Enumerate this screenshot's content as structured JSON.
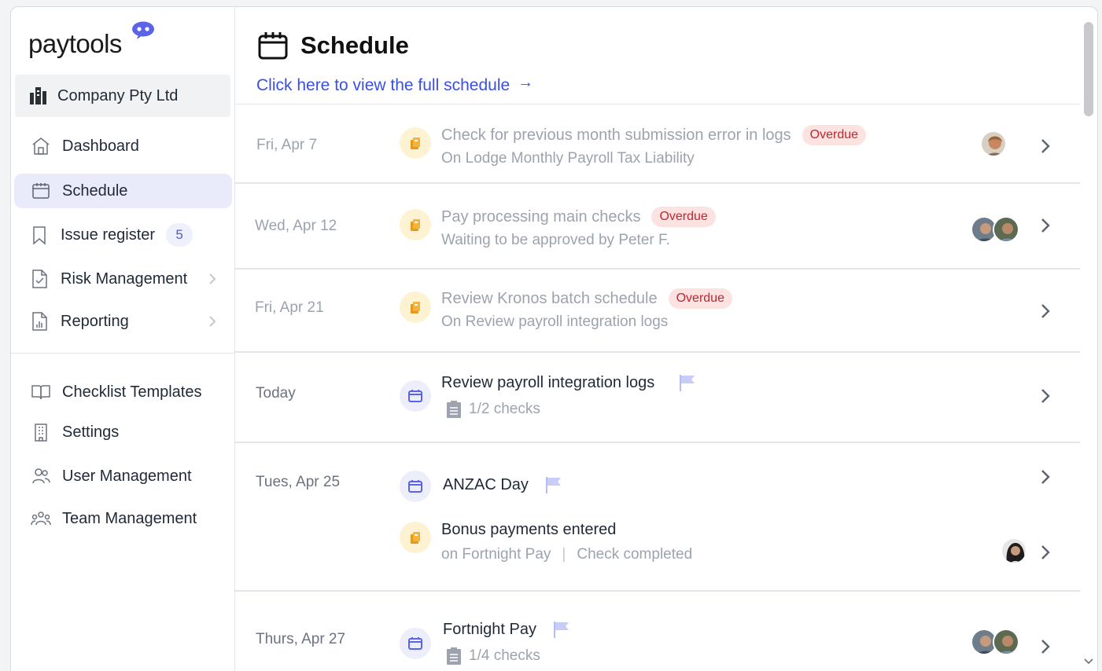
{
  "brand": {
    "name": "paytools",
    "accent": "#4f5bd5",
    "link": "#3b4fe0"
  },
  "company": {
    "name": "Company Pty Ltd"
  },
  "nav": {
    "dashboard": "Dashboard",
    "schedule": "Schedule",
    "issue_register": "Issue register",
    "issue_count": "5",
    "risk": "Risk Management",
    "reporting": "Reporting",
    "checklist_templates": "Checklist Templates",
    "settings": "Settings",
    "user_management": "User Management",
    "team_management": "Team Management"
  },
  "page": {
    "title": "Schedule",
    "full_link": "Click here to view the full schedule",
    "link_arrow": "→"
  },
  "rows": [
    {
      "date": "Fri, Apr 7",
      "title": "Check for previous month submission error in logs",
      "status": "Overdue",
      "sub": "On Lodge Monthly Payroll Tax Liability"
    },
    {
      "date": "Wed, Apr 12",
      "title": "Pay processing main checks",
      "status": "Overdue",
      "sub": "Waiting to be approved by Peter F."
    },
    {
      "date": "Fri, Apr 21",
      "title": "Review Kronos batch schedule",
      "status": "Overdue",
      "sub": "On Review payroll integration logs"
    },
    {
      "date": "Today",
      "title": "Review payroll integration logs",
      "checks": "1/2 checks"
    },
    {
      "date": "Tues, Apr 25",
      "title": "ANZAC Day",
      "title2": "Bonus payments entered",
      "sub_a": "on Fortnight Pay",
      "sub_sep": "|",
      "sub_b": "Check completed"
    },
    {
      "date": "Thurs, Apr 27",
      "title": "Fortnight Pay",
      "checks": "1/4 checks"
    }
  ]
}
